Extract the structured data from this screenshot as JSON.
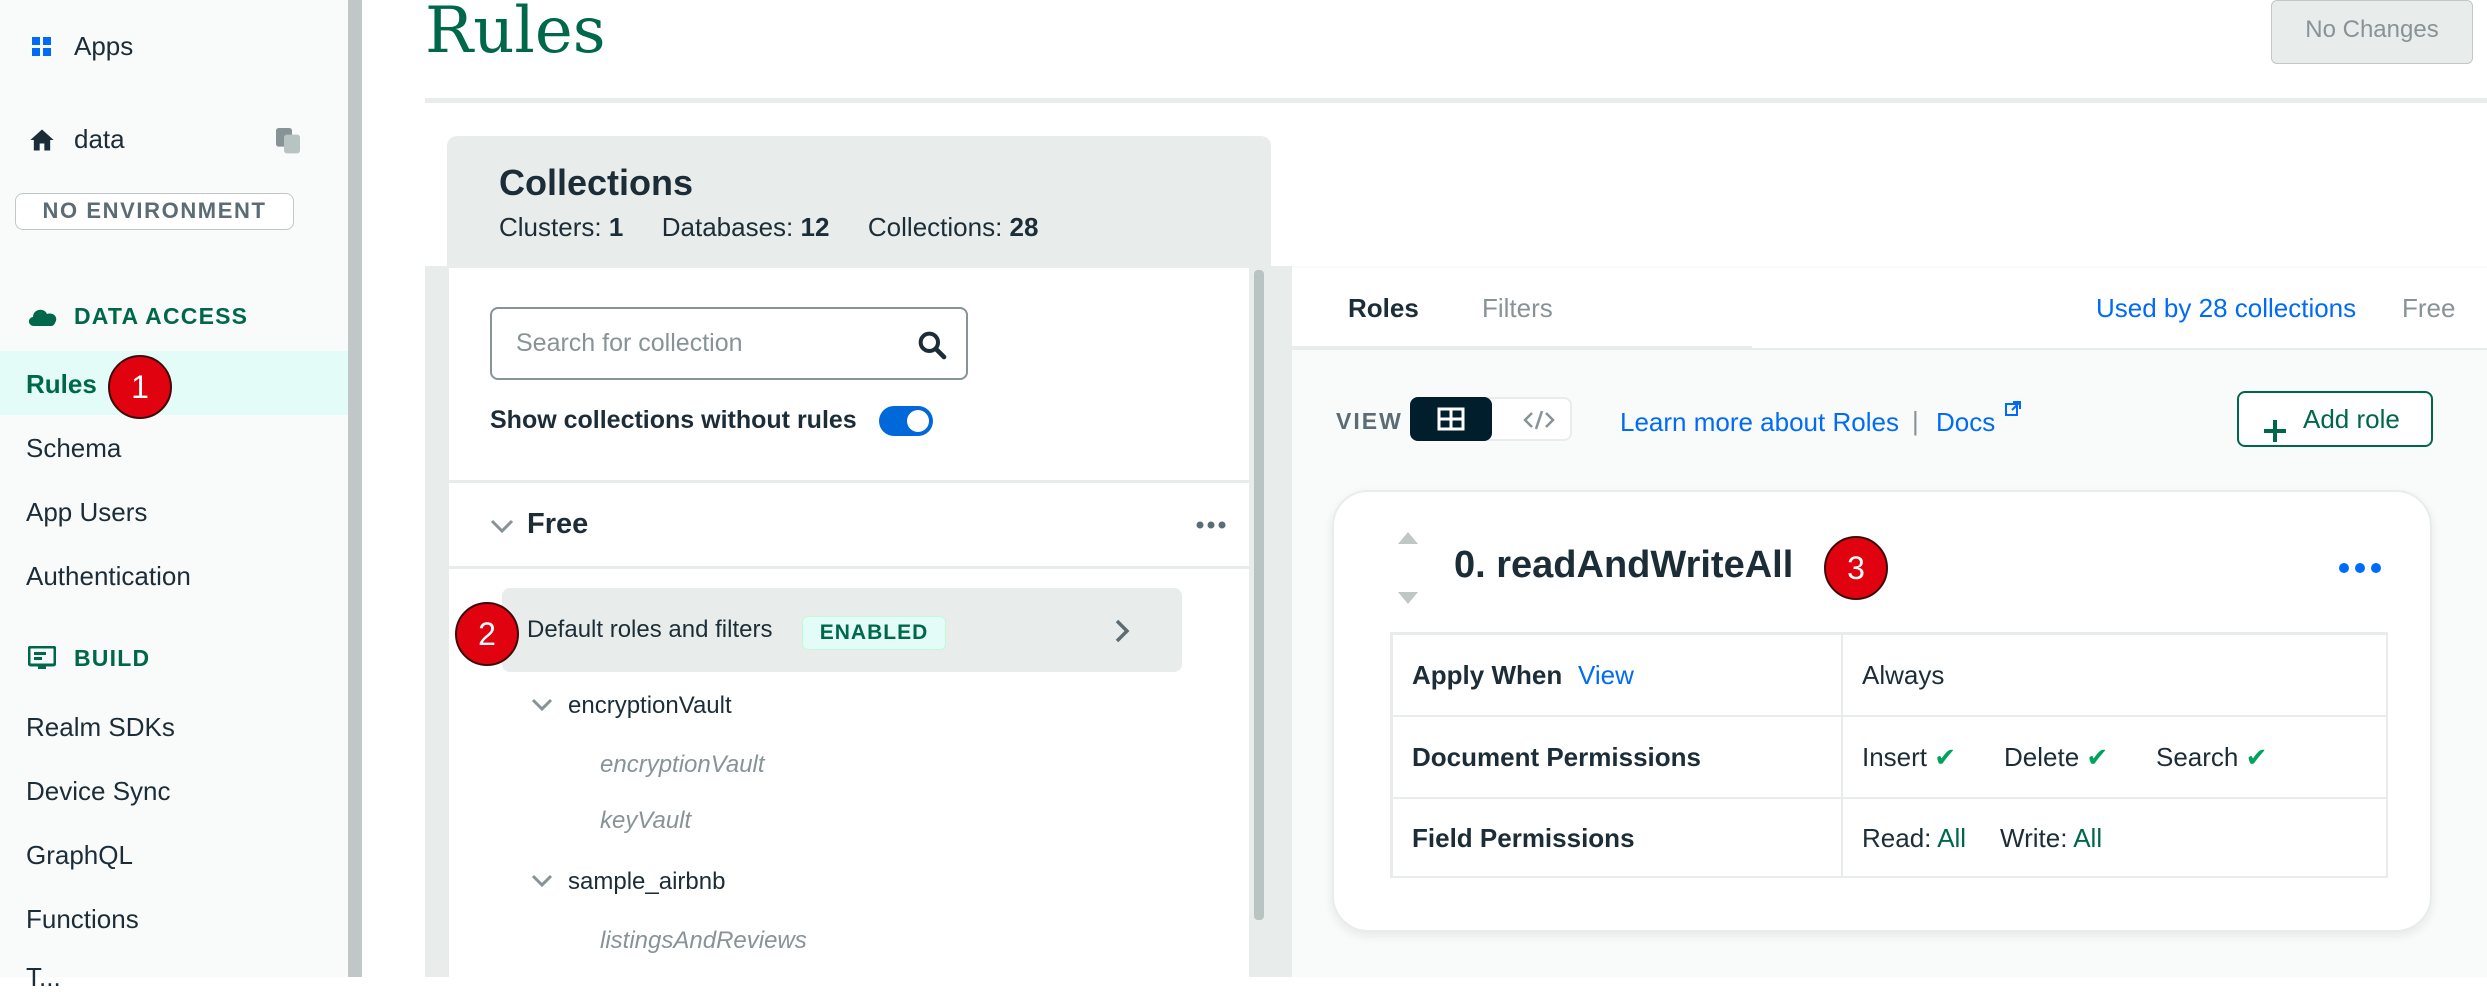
{
  "sidebar": {
    "apps_label": "Apps",
    "app_name": "data",
    "environment": "NO ENVIRONMENT",
    "data_access_section": "DATA ACCESS",
    "data_access_items": [
      "Rules",
      "Schema",
      "App Users",
      "Authentication"
    ],
    "build_section": "BUILD",
    "build_items": [
      "Realm SDKs",
      "Device Sync",
      "GraphQL",
      "Functions",
      "T..."
    ]
  },
  "header": {
    "title": "Rules",
    "no_changes_button": "No Changes"
  },
  "collections": {
    "title": "Collections",
    "clusters_label": "Clusters:",
    "clusters_value": "1",
    "databases_label": "Databases:",
    "databases_value": "12",
    "collections_label": "Collections:",
    "collections_value": "28",
    "search_placeholder": "Search for collection",
    "show_without_rules_label": "Show collections without rules",
    "cluster_name": "Free",
    "default_row_label": "Default roles and filters",
    "default_row_badge": "ENABLED",
    "databases": [
      {
        "name": "encryptionVault",
        "collections": [
          "encryptionVault",
          "keyVault"
        ]
      },
      {
        "name": "sample_airbnb",
        "collections": [
          "listingsAndReviews"
        ]
      }
    ]
  },
  "right_panel": {
    "tabs": [
      "Roles",
      "Filters"
    ],
    "used_by": "Used by 28 collections",
    "cluster": "Free",
    "view_label": "VIEW",
    "learn_more": "Learn more about Roles",
    "separator": "|",
    "docs": "Docs",
    "add_role": "Add role",
    "role": {
      "name": "0. readAndWriteAll",
      "apply_when_label": "Apply When",
      "apply_when_link": "View",
      "apply_when_value": "Always",
      "document_permissions_label": "Document Permissions",
      "insert": "Insert",
      "delete": "Delete",
      "search": "Search",
      "field_permissions_label": "Field Permissions",
      "read_label": "Read:",
      "read_value": "All",
      "write_label": "Write:",
      "write_value": "All"
    }
  },
  "annotations": [
    "1",
    "2",
    "3"
  ],
  "colors": {
    "brand_green": "#00684a",
    "link_blue": "#016bf8",
    "annotation_red": "#e0020f",
    "check_green": "#00a35c"
  }
}
